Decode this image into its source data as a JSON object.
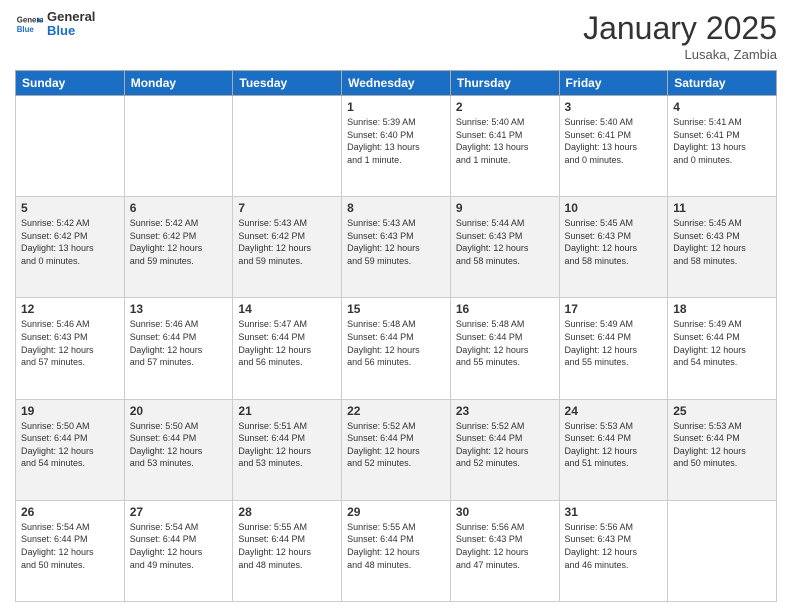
{
  "header": {
    "logo_general": "General",
    "logo_blue": "Blue",
    "month_title": "January 2025",
    "location": "Lusaka, Zambia"
  },
  "days_of_week": [
    "Sunday",
    "Monday",
    "Tuesday",
    "Wednesday",
    "Thursday",
    "Friday",
    "Saturday"
  ],
  "weeks": [
    [
      {
        "day": "",
        "info": ""
      },
      {
        "day": "",
        "info": ""
      },
      {
        "day": "",
        "info": ""
      },
      {
        "day": "1",
        "info": "Sunrise: 5:39 AM\nSunset: 6:40 PM\nDaylight: 13 hours\nand 1 minute."
      },
      {
        "day": "2",
        "info": "Sunrise: 5:40 AM\nSunset: 6:41 PM\nDaylight: 13 hours\nand 1 minute."
      },
      {
        "day": "3",
        "info": "Sunrise: 5:40 AM\nSunset: 6:41 PM\nDaylight: 13 hours\nand 0 minutes."
      },
      {
        "day": "4",
        "info": "Sunrise: 5:41 AM\nSunset: 6:41 PM\nDaylight: 13 hours\nand 0 minutes."
      }
    ],
    [
      {
        "day": "5",
        "info": "Sunrise: 5:42 AM\nSunset: 6:42 PM\nDaylight: 13 hours\nand 0 minutes."
      },
      {
        "day": "6",
        "info": "Sunrise: 5:42 AM\nSunset: 6:42 PM\nDaylight: 12 hours\nand 59 minutes."
      },
      {
        "day": "7",
        "info": "Sunrise: 5:43 AM\nSunset: 6:42 PM\nDaylight: 12 hours\nand 59 minutes."
      },
      {
        "day": "8",
        "info": "Sunrise: 5:43 AM\nSunset: 6:43 PM\nDaylight: 12 hours\nand 59 minutes."
      },
      {
        "day": "9",
        "info": "Sunrise: 5:44 AM\nSunset: 6:43 PM\nDaylight: 12 hours\nand 58 minutes."
      },
      {
        "day": "10",
        "info": "Sunrise: 5:45 AM\nSunset: 6:43 PM\nDaylight: 12 hours\nand 58 minutes."
      },
      {
        "day": "11",
        "info": "Sunrise: 5:45 AM\nSunset: 6:43 PM\nDaylight: 12 hours\nand 58 minutes."
      }
    ],
    [
      {
        "day": "12",
        "info": "Sunrise: 5:46 AM\nSunset: 6:43 PM\nDaylight: 12 hours\nand 57 minutes."
      },
      {
        "day": "13",
        "info": "Sunrise: 5:46 AM\nSunset: 6:44 PM\nDaylight: 12 hours\nand 57 minutes."
      },
      {
        "day": "14",
        "info": "Sunrise: 5:47 AM\nSunset: 6:44 PM\nDaylight: 12 hours\nand 56 minutes."
      },
      {
        "day": "15",
        "info": "Sunrise: 5:48 AM\nSunset: 6:44 PM\nDaylight: 12 hours\nand 56 minutes."
      },
      {
        "day": "16",
        "info": "Sunrise: 5:48 AM\nSunset: 6:44 PM\nDaylight: 12 hours\nand 55 minutes."
      },
      {
        "day": "17",
        "info": "Sunrise: 5:49 AM\nSunset: 6:44 PM\nDaylight: 12 hours\nand 55 minutes."
      },
      {
        "day": "18",
        "info": "Sunrise: 5:49 AM\nSunset: 6:44 PM\nDaylight: 12 hours\nand 54 minutes."
      }
    ],
    [
      {
        "day": "19",
        "info": "Sunrise: 5:50 AM\nSunset: 6:44 PM\nDaylight: 12 hours\nand 54 minutes."
      },
      {
        "day": "20",
        "info": "Sunrise: 5:50 AM\nSunset: 6:44 PM\nDaylight: 12 hours\nand 53 minutes."
      },
      {
        "day": "21",
        "info": "Sunrise: 5:51 AM\nSunset: 6:44 PM\nDaylight: 12 hours\nand 53 minutes."
      },
      {
        "day": "22",
        "info": "Sunrise: 5:52 AM\nSunset: 6:44 PM\nDaylight: 12 hours\nand 52 minutes."
      },
      {
        "day": "23",
        "info": "Sunrise: 5:52 AM\nSunset: 6:44 PM\nDaylight: 12 hours\nand 52 minutes."
      },
      {
        "day": "24",
        "info": "Sunrise: 5:53 AM\nSunset: 6:44 PM\nDaylight: 12 hours\nand 51 minutes."
      },
      {
        "day": "25",
        "info": "Sunrise: 5:53 AM\nSunset: 6:44 PM\nDaylight: 12 hours\nand 50 minutes."
      }
    ],
    [
      {
        "day": "26",
        "info": "Sunrise: 5:54 AM\nSunset: 6:44 PM\nDaylight: 12 hours\nand 50 minutes."
      },
      {
        "day": "27",
        "info": "Sunrise: 5:54 AM\nSunset: 6:44 PM\nDaylight: 12 hours\nand 49 minutes."
      },
      {
        "day": "28",
        "info": "Sunrise: 5:55 AM\nSunset: 6:44 PM\nDaylight: 12 hours\nand 48 minutes."
      },
      {
        "day": "29",
        "info": "Sunrise: 5:55 AM\nSunset: 6:44 PM\nDaylight: 12 hours\nand 48 minutes."
      },
      {
        "day": "30",
        "info": "Sunrise: 5:56 AM\nSunset: 6:43 PM\nDaylight: 12 hours\nand 47 minutes."
      },
      {
        "day": "31",
        "info": "Sunrise: 5:56 AM\nSunset: 6:43 PM\nDaylight: 12 hours\nand 46 minutes."
      },
      {
        "day": "",
        "info": ""
      }
    ]
  ]
}
